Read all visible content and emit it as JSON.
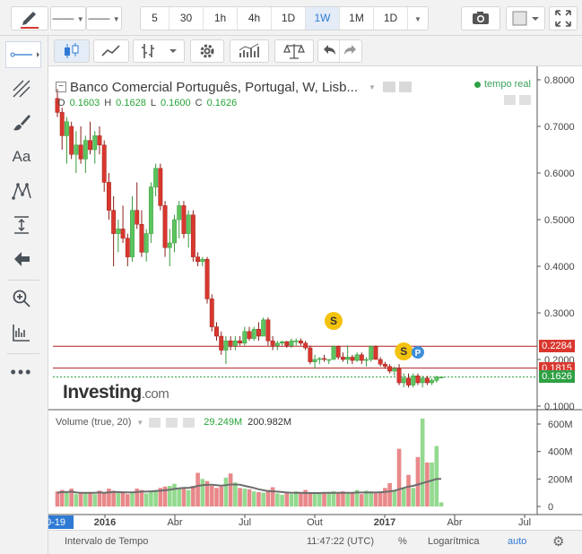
{
  "toolbar": {
    "line_label": "——",
    "line_label2": "——",
    "intervals": [
      "5",
      "30",
      "1h",
      "4h",
      "1D",
      "1W",
      "1M",
      "1D"
    ],
    "active_interval": "1W"
  },
  "chart_header": {
    "title": "Banco Comercial Português, Portugal, W, Lisb...",
    "realtime": "tempo real",
    "ohlc": {
      "o_label": "O",
      "o": "0.1603",
      "h_label": "H",
      "h": "0.1628",
      "l_label": "L",
      "l": "0.1600",
      "c_label": "C",
      "c": "0.1626"
    }
  },
  "watermark": {
    "main": "Investing",
    "suffix": ".com"
  },
  "volume_legend": {
    "label": "Volume (true, 20)",
    "v1": "29.249M",
    "v2": "200.982M"
  },
  "bottom": {
    "range": "Intervalo de Tempo",
    "time": "11:47:22 (UTC)",
    "pct": "%",
    "log": "Logarítmica",
    "auto": "auto"
  },
  "colors": {
    "up": "#5cc55f",
    "down": "#d9372e",
    "vol_up": "#93d98f",
    "vol_down": "#e8888a",
    "accent": "#2f7ad4",
    "hline": "#b22222"
  },
  "chart_data": {
    "type": "candlestick",
    "ylim": [
      0.1,
      0.8
    ],
    "y_ticks": [
      "0.8000",
      "0.7000",
      "0.6000",
      "0.5000",
      "0.4000",
      "0.3000",
      "0.2000",
      "0.1000"
    ],
    "x_ticks": [
      "0-19",
      "2016",
      "Abr",
      "Jul",
      "Out",
      "2017",
      "Abr",
      "Jul"
    ],
    "price_tags": [
      {
        "value": 0.2284,
        "label": "0.2284",
        "color": "#d9372e"
      },
      {
        "value": 0.1815,
        "label": "0.1815",
        "color": "#d9372e"
      },
      {
        "value": 0.1626,
        "label": "0.1626",
        "color": "#2ea043"
      }
    ],
    "hlines": [
      0.2284,
      0.1815
    ],
    "last_price": 0.1626,
    "event_markers": [
      {
        "label": "S",
        "week": 59
      },
      {
        "label": "S",
        "week": 74
      },
      {
        "label": "P",
        "week": 77
      }
    ],
    "candles": [
      [
        0.76,
        0.78,
        0.72,
        0.73
      ],
      [
        0.73,
        0.74,
        0.65,
        0.68
      ],
      [
        0.68,
        0.72,
        0.62,
        0.71
      ],
      [
        0.7,
        0.71,
        0.63,
        0.64
      ],
      [
        0.64,
        0.69,
        0.6,
        0.66
      ],
      [
        0.66,
        0.7,
        0.62,
        0.63
      ],
      [
        0.63,
        0.68,
        0.6,
        0.67
      ],
      [
        0.67,
        0.71,
        0.64,
        0.65
      ],
      [
        0.65,
        0.69,
        0.62,
        0.68
      ],
      [
        0.68,
        0.7,
        0.64,
        0.66
      ],
      [
        0.66,
        0.67,
        0.56,
        0.58
      ],
      [
        0.58,
        0.6,
        0.5,
        0.52
      ],
      [
        0.52,
        0.55,
        0.4,
        0.47
      ],
      [
        0.47,
        0.5,
        0.43,
        0.48
      ],
      [
        0.48,
        0.53,
        0.45,
        0.46
      ],
      [
        0.46,
        0.47,
        0.4,
        0.42
      ],
      [
        0.42,
        0.55,
        0.41,
        0.52
      ],
      [
        0.52,
        0.58,
        0.48,
        0.49
      ],
      [
        0.49,
        0.52,
        0.42,
        0.43
      ],
      [
        0.43,
        0.48,
        0.41,
        0.47
      ],
      [
        0.47,
        0.58,
        0.45,
        0.57
      ],
      [
        0.57,
        0.62,
        0.55,
        0.61
      ],
      [
        0.61,
        0.62,
        0.52,
        0.53
      ],
      [
        0.53,
        0.54,
        0.42,
        0.44
      ],
      [
        0.44,
        0.48,
        0.4,
        0.45
      ],
      [
        0.45,
        0.51,
        0.43,
        0.5
      ],
      [
        0.5,
        0.54,
        0.46,
        0.53
      ],
      [
        0.53,
        0.54,
        0.46,
        0.47
      ],
      [
        0.47,
        0.52,
        0.44,
        0.51
      ],
      [
        0.51,
        0.52,
        0.41,
        0.42
      ],
      [
        0.42,
        0.43,
        0.4,
        0.41
      ],
      [
        0.41,
        0.42,
        0.4,
        0.415
      ],
      [
        0.415,
        0.42,
        0.32,
        0.33
      ],
      [
        0.33,
        0.34,
        0.26,
        0.27
      ],
      [
        0.27,
        0.28,
        0.24,
        0.25
      ],
      [
        0.25,
        0.26,
        0.21,
        0.22
      ],
      [
        0.22,
        0.25,
        0.19,
        0.24
      ],
      [
        0.24,
        0.25,
        0.22,
        0.23
      ],
      [
        0.23,
        0.25,
        0.22,
        0.24
      ],
      [
        0.24,
        0.25,
        0.23,
        0.235
      ],
      [
        0.235,
        0.27,
        0.23,
        0.26
      ],
      [
        0.26,
        0.27,
        0.24,
        0.245
      ],
      [
        0.245,
        0.27,
        0.24,
        0.265
      ],
      [
        0.265,
        0.28,
        0.24,
        0.25
      ],
      [
        0.25,
        0.29,
        0.25,
        0.285
      ],
      [
        0.285,
        0.29,
        0.23,
        0.24
      ],
      [
        0.24,
        0.25,
        0.22,
        0.23
      ],
      [
        0.23,
        0.24,
        0.22,
        0.235
      ],
      [
        0.235,
        0.24,
        0.23,
        0.238
      ],
      [
        0.238,
        0.24,
        0.225,
        0.23
      ],
      [
        0.23,
        0.245,
        0.225,
        0.24
      ],
      [
        0.24,
        0.245,
        0.23,
        0.24
      ],
      [
        0.24,
        0.245,
        0.23,
        0.235
      ],
      [
        0.235,
        0.24,
        0.22,
        0.225
      ],
      [
        0.225,
        0.23,
        0.19,
        0.195
      ],
      [
        0.195,
        0.21,
        0.18,
        0.2
      ],
      [
        0.2,
        0.205,
        0.19,
        0.202
      ],
      [
        0.202,
        0.21,
        0.195,
        0.2
      ],
      [
        0.2,
        0.2,
        0.19,
        0.2
      ],
      [
        0.2,
        0.23,
        0.2,
        0.228
      ],
      [
        0.228,
        0.23,
        0.2,
        0.205
      ],
      [
        0.205,
        0.215,
        0.195,
        0.2
      ],
      [
        0.2,
        0.23,
        0.19,
        0.205
      ],
      [
        0.205,
        0.21,
        0.19,
        0.198
      ],
      [
        0.198,
        0.215,
        0.195,
        0.21
      ],
      [
        0.21,
        0.215,
        0.19,
        0.198
      ],
      [
        0.198,
        0.205,
        0.185,
        0.2
      ],
      [
        0.2,
        0.23,
        0.195,
        0.228
      ],
      [
        0.228,
        0.23,
        0.2,
        0.2
      ],
      [
        0.2,
        0.205,
        0.185,
        0.19
      ],
      [
        0.19,
        0.195,
        0.18,
        0.185
      ],
      [
        0.185,
        0.19,
        0.17,
        0.175
      ],
      [
        0.175,
        0.185,
        0.165,
        0.18
      ],
      [
        0.18,
        0.19,
        0.145,
        0.15
      ],
      [
        0.15,
        0.17,
        0.14,
        0.16
      ],
      [
        0.16,
        0.17,
        0.14,
        0.145
      ],
      [
        0.145,
        0.17,
        0.14,
        0.165
      ],
      [
        0.165,
        0.17,
        0.145,
        0.15
      ],
      [
        0.15,
        0.165,
        0.14,
        0.16
      ],
      [
        0.16,
        0.165,
        0.145,
        0.15
      ],
      [
        0.15,
        0.16,
        0.145,
        0.155
      ],
      [
        0.155,
        0.165,
        0.15,
        0.162
      ],
      [
        0.1603,
        0.1628,
        0.16,
        0.1626
      ]
    ],
    "volume_ylim": [
      0,
      700
    ],
    "volume_ticks": [
      "600M",
      "400M",
      "200M",
      "0"
    ],
    "volumes": [
      110,
      120,
      100,
      130,
      90,
      95,
      100,
      105,
      90,
      115,
      105,
      130,
      115,
      100,
      110,
      90,
      100,
      130,
      120,
      95,
      110,
      120,
      135,
      145,
      150,
      165,
      135,
      140,
      120,
      150,
      245,
      200,
      185,
      150,
      135,
      145,
      210,
      240,
      175,
      135,
      130,
      125,
      110,
      105,
      100,
      120,
      140,
      95,
      85,
      105,
      90,
      110,
      105,
      120,
      100,
      95,
      100,
      100,
      95,
      110,
      100,
      110,
      100,
      95,
      120,
      90,
      115,
      110,
      95,
      100,
      135,
      170,
      120,
      420,
      130,
      230,
      135,
      360,
      640,
      320,
      320,
      440,
      30
    ],
    "volume_ma": [
      100,
      105,
      105,
      108,
      102,
      100,
      100,
      100,
      100,
      103,
      100,
      103,
      105,
      105,
      103,
      103,
      103,
      105,
      108,
      108,
      110,
      112,
      115,
      118,
      122,
      128,
      132,
      135,
      135,
      140,
      150,
      155,
      158,
      158,
      155,
      152,
      155,
      160,
      160,
      158,
      150,
      143,
      135,
      125,
      118,
      112,
      110,
      108,
      105,
      102,
      100,
      100,
      100,
      98,
      98,
      98,
      98,
      100,
      100,
      100,
      100,
      100,
      100,
      100,
      102,
      102,
      102,
      102,
      102,
      104,
      106,
      110,
      115,
      125,
      135,
      145,
      150,
      160,
      170,
      180,
      190,
      200,
      200
    ]
  }
}
